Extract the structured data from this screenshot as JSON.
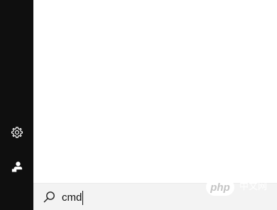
{
  "left_rail": {
    "items": [
      {
        "icon": "gear-icon"
      },
      {
        "icon": "person-icon"
      }
    ]
  },
  "search": {
    "value": "cmd",
    "icon": "search-icon"
  },
  "watermark": {
    "badge": "php",
    "label": "中文网"
  },
  "colors": {
    "rail_bg": "#0f0f0f",
    "search_bg": "#f3f3f3",
    "icon_color": "#ffffff"
  }
}
